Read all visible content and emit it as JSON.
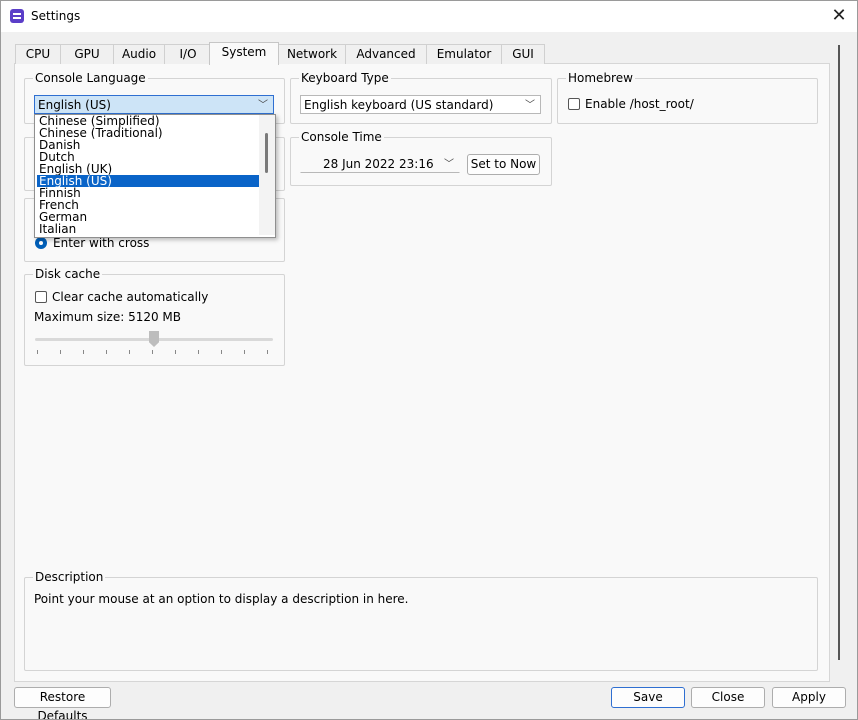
{
  "window": {
    "title": "Settings"
  },
  "tabs": [
    {
      "label": "CPU"
    },
    {
      "label": "GPU"
    },
    {
      "label": "Audio"
    },
    {
      "label": "I/O"
    },
    {
      "label": "System",
      "active": true
    },
    {
      "label": "Network"
    },
    {
      "label": "Advanced"
    },
    {
      "label": "Emulator"
    },
    {
      "label": "GUI"
    }
  ],
  "console_language": {
    "title": "Console Language",
    "value": "English (US)",
    "options": [
      "Chinese (Simplified)",
      "Chinese (Traditional)",
      "Danish",
      "Dutch",
      "English (UK)",
      "English (US)",
      "Finnish",
      "French",
      "German",
      "Italian"
    ],
    "selected_index": 5
  },
  "keyboard_type": {
    "title": "Keyboard Type",
    "value": "English keyboard (US standard)"
  },
  "homebrew": {
    "title": "Homebrew",
    "checkbox_label": "Enable /host_root/",
    "checked": false
  },
  "console_time": {
    "title": "Console Time",
    "value": "28 Jun 2022 23:16",
    "set_button": "Set to Now"
  },
  "enter_button": {
    "radio_label": "Enter with cross",
    "selected": true
  },
  "disk_cache": {
    "title": "Disk cache",
    "clear_label": "Clear cache automatically",
    "clear_checked": false,
    "max_size_label": "Maximum size: 5120 MB",
    "slider_level": 0.5
  },
  "description": {
    "title": "Description",
    "text": "Point your mouse at an option to display a description in here."
  },
  "footer": {
    "restore": "Restore Defaults",
    "save": "Save",
    "close": "Close",
    "apply": "Apply"
  },
  "icons": {
    "app": "settings-app-icon",
    "close": "close-icon",
    "caret": "chevron-down-icon"
  }
}
